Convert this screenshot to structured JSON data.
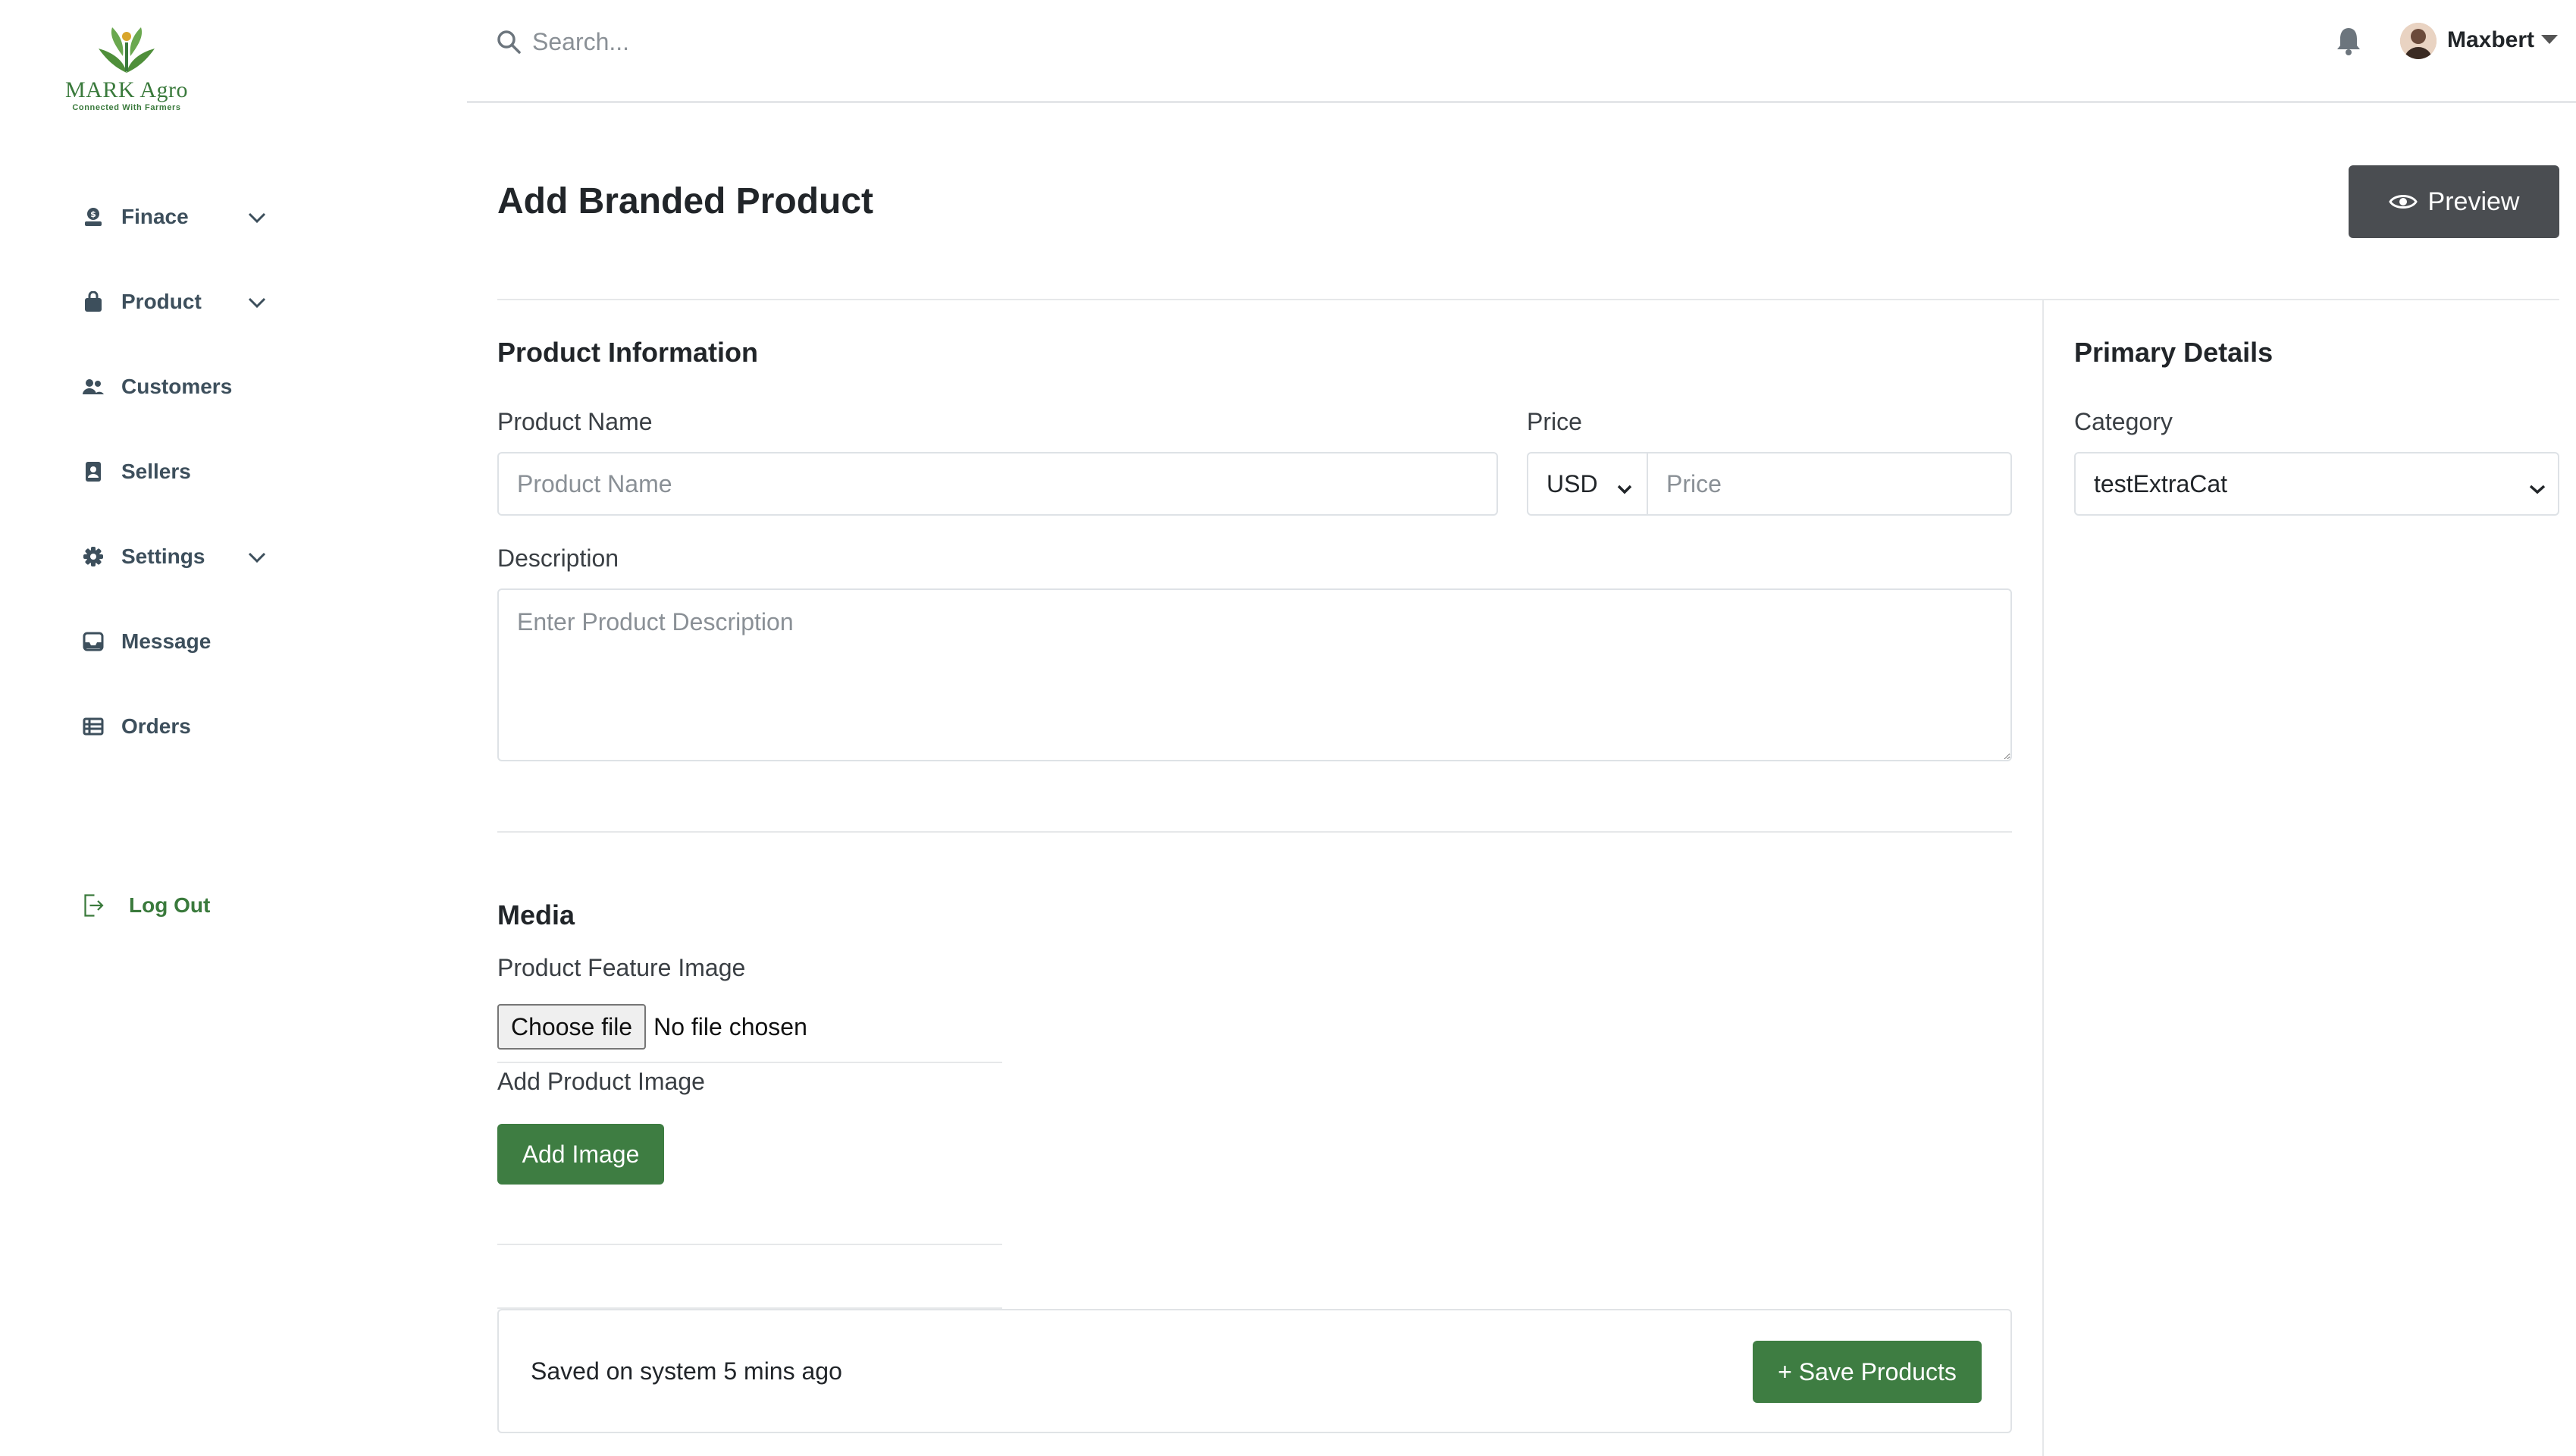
{
  "brand": {
    "name": "MARK Agro",
    "tagline": "Connected With Farmers",
    "color": "#3a7a3c"
  },
  "sidebar": {
    "items": [
      {
        "label": "Finace",
        "icon": "finance-icon",
        "has_chevron": true
      },
      {
        "label": "Product",
        "icon": "bag-icon",
        "has_chevron": true
      },
      {
        "label": "Customers",
        "icon": "users-icon",
        "has_chevron": false
      },
      {
        "label": "Sellers",
        "icon": "id-card-icon",
        "has_chevron": false
      },
      {
        "label": "Settings",
        "icon": "gear-icon",
        "has_chevron": true
      },
      {
        "label": "Message",
        "icon": "inbox-icon",
        "has_chevron": false
      },
      {
        "label": "Orders",
        "icon": "table-list-icon",
        "has_chevron": false
      }
    ],
    "logout": {
      "label": "Log Out",
      "icon": "logout-icon"
    }
  },
  "topbar": {
    "search_placeholder": "Search...",
    "user_name": "Maxbert"
  },
  "page": {
    "title": "Add Branded Product",
    "preview_label": "Preview"
  },
  "product_info": {
    "section_title": "Product Information",
    "name_label": "Product Name",
    "name_placeholder": "Product Name",
    "name_value": "",
    "price_label": "Price",
    "currency": "USD",
    "price_placeholder": "Price",
    "price_value": "",
    "description_label": "Description",
    "description_placeholder": "Enter Product Description",
    "description_value": ""
  },
  "media": {
    "section_title": "Media",
    "feature_image_label": "Product Feature Image",
    "choose_file_label": "Choose file",
    "file_status": "No file chosen",
    "add_image_label": "Add Product Image",
    "add_image_button": "Add Image"
  },
  "save_bar": {
    "status": "Saved on system 5 mins ago",
    "save_button": "+ Save Products"
  },
  "primary_details": {
    "section_title": "Primary Details",
    "category_label": "Category",
    "category_value": "testExtraCat"
  },
  "colors": {
    "accent_green": "#3e7d42",
    "dark_button": "#4a4d51",
    "nav_text": "#3d4f5c"
  }
}
